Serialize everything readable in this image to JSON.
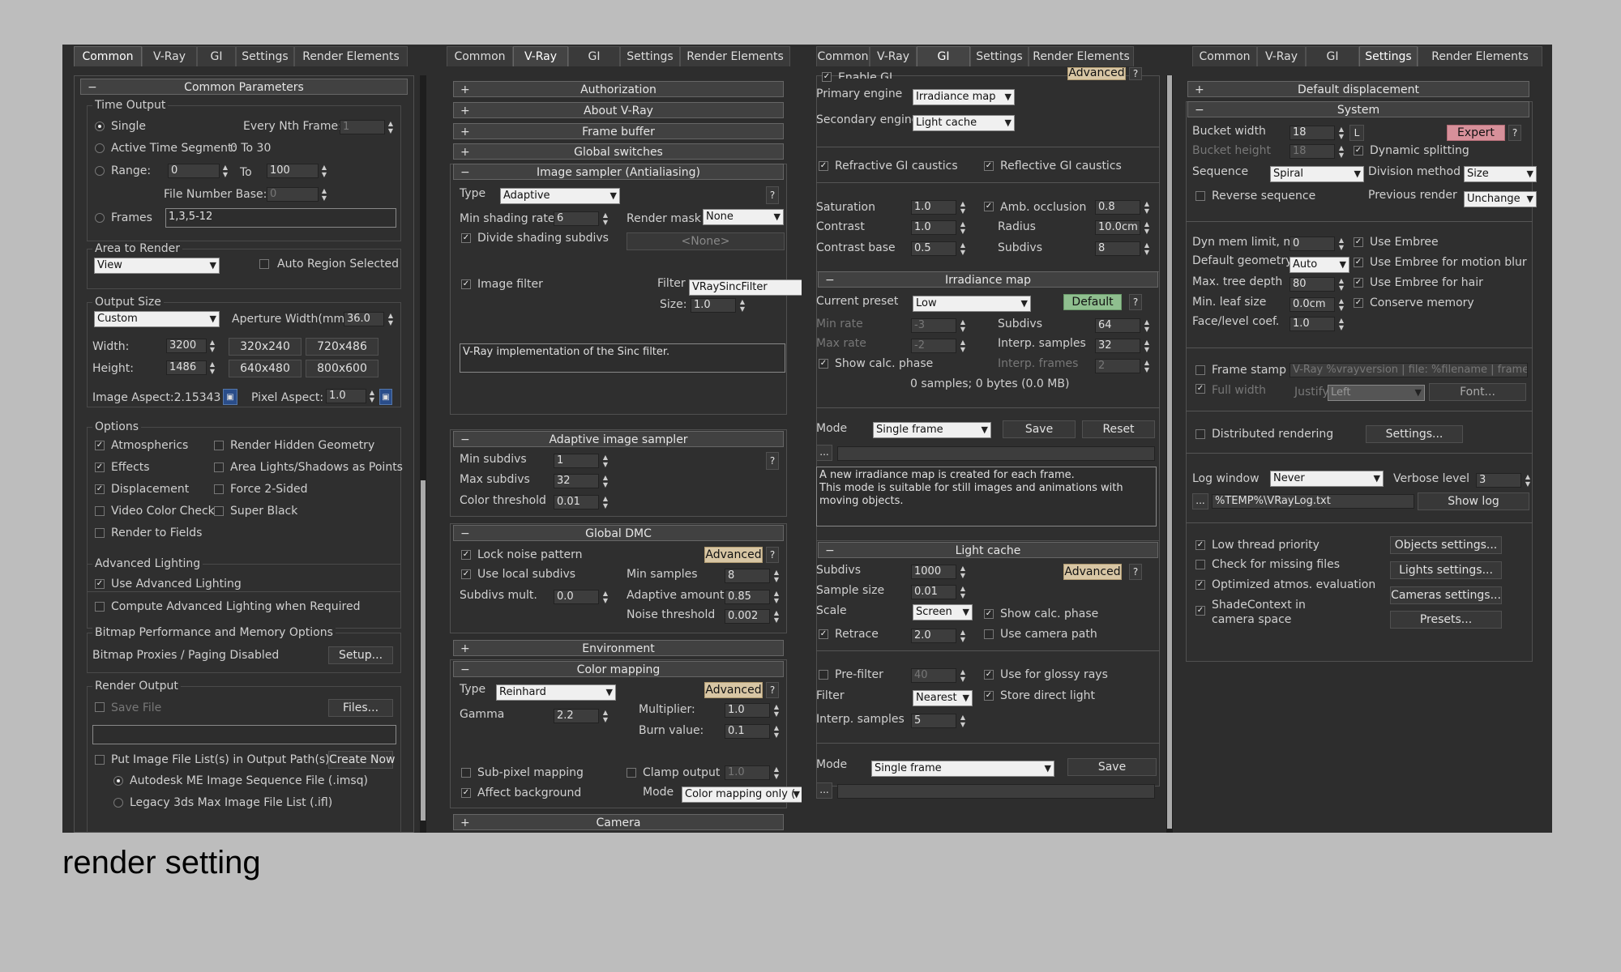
{
  "caption": "render setting",
  "tabs": [
    "Common",
    "V-Ray",
    "GI",
    "Settings",
    "Render Elements"
  ],
  "p1": {
    "common_params": "Common Parameters",
    "time_output": "Time Output",
    "single": "Single",
    "every_nth": "Every Nth Frame:",
    "every_nth_val": "1",
    "active_time": "Active Time Segment:",
    "active_time_val": "0 To 30",
    "range": "Range:",
    "range_from": "0",
    "to": "To",
    "range_to": "100",
    "file_num_base": "File Number Base:",
    "file_num_base_val": "0",
    "frames": "Frames",
    "frames_val": "1,3,5-12",
    "area_to_render": "Area to Render",
    "view": "View",
    "auto_region": "Auto Region Selected",
    "output_size": "Output Size",
    "custom": "Custom",
    "aperture": "Aperture Width(mm):",
    "aperture_val": "36.0",
    "width": "Width:",
    "width_val": "3200",
    "height": "Height:",
    "height_val": "1486",
    "preset1": "320x240",
    "preset2": "720x486",
    "preset3": "640x480",
    "preset4": "800x600",
    "image_aspect": "Image Aspect:2.15343",
    "pixel_aspect": "Pixel Aspect:",
    "pixel_aspect_val": "1.0",
    "options": "Options",
    "atmospherics": "Atmospherics",
    "render_hidden": "Render Hidden Geometry",
    "effects": "Effects",
    "area_lights": "Area Lights/Shadows as Points",
    "displacement": "Displacement",
    "force2": "Force 2-Sided",
    "video_color": "Video Color Check",
    "super_black": "Super Black",
    "render_fields": "Render to Fields",
    "adv_lighting": "Advanced Lighting",
    "use_adv": "Use Advanced Lighting",
    "compute_adv": "Compute Advanced Lighting when Required",
    "bitmap_perf": "Bitmap Performance and Memory Options",
    "bitmap_proxies": "Bitmap Proxies / Paging Disabled",
    "setup": "Setup...",
    "render_output": "Render Output",
    "save_file": "Save File",
    "files": "Files...",
    "put_image": "Put Image File List(s) in Output Path(s)",
    "create_now": "Create Now",
    "autodesk_me": "Autodesk ME Image Sequence File (.imsq)",
    "legacy": "Legacy 3ds Max Image File List (.ifl)"
  },
  "p2": {
    "authorization": "Authorization",
    "about": "About V-Ray",
    "frame_buffer": "Frame buffer",
    "global_switches": "Global switches",
    "image_sampler": "Image sampler (Antialiasing)",
    "type": "Type",
    "type_val": "Adaptive",
    "min_shading": "Min shading rate",
    "min_shading_val": "6",
    "render_mask": "Render mask",
    "render_mask_val": "None",
    "divide": "Divide shading subdivs",
    "none_btn": "<None>",
    "image_filter": "Image filter",
    "filter": "Filter",
    "filter_val": "VRaySincFilter",
    "size": "Size:",
    "size_val": "1.0",
    "filter_desc": "V-Ray implementation of the Sinc filter.",
    "adaptive_sampler": "Adaptive image sampler",
    "min_subdivs": "Min subdivs",
    "min_subdivs_val": "1",
    "max_subdivs": "Max subdivs",
    "max_subdivs_val": "32",
    "color_thr": "Color threshold",
    "color_thr_val": "0.01",
    "global_dmc": "Global DMC",
    "lock_noise": "Lock noise pattern",
    "advanced": "Advanced",
    "use_local": "Use local subdivs",
    "min_samples": "Min samples",
    "min_samples_val": "8",
    "subdivs_mult": "Subdivs mult.",
    "subdivs_mult_val": "0.0",
    "adaptive_amount": "Adaptive amount",
    "adaptive_amount_val": "0.85",
    "noise_thr": "Noise threshold",
    "noise_thr_val": "0.002",
    "environment": "Environment",
    "color_mapping": "Color mapping",
    "cm_type_val": "Reinhard",
    "multiplier": "Multiplier:",
    "multiplier_val": "1.0",
    "gamma": "Gamma",
    "gamma_val": "2.2",
    "burn": "Burn value:",
    "burn_val": "0.1",
    "subpixel": "Sub-pixel mapping",
    "clamp": "Clamp output",
    "clamp_val": "1.0",
    "affect_bg": "Affect background",
    "mode": "Mode",
    "mode_val": "Color mapping only (",
    "camera": "Camera"
  },
  "p3": {
    "enable_gi": "Enable GI",
    "advanced": "Advanced",
    "primary": "Primary engine",
    "primary_val": "Irradiance map",
    "secondary": "Secondary engine",
    "secondary_val": "Light cache",
    "refr_caustics": "Refractive GI caustics",
    "refl_caustics": "Reflective GI caustics",
    "saturation": "Saturation",
    "saturation_val": "1.0",
    "amb_occ": "Amb. occlusion",
    "amb_occ_val": "0.8",
    "contrast": "Contrast",
    "contrast_val": "1.0",
    "radius": "Radius",
    "radius_val": "10.0cm",
    "contrast_base": "Contrast base",
    "contrast_base_val": "0.5",
    "subdivs": "Subdivs",
    "subdivs_val": "8",
    "irradiance_map": "Irradiance map",
    "current_preset": "Current preset",
    "preset_val": "Low",
    "default": "Default",
    "min_rate": "Min rate",
    "min_rate_val": "-3",
    "im_subdivs_val": "64",
    "max_rate": "Max rate",
    "max_rate_val": "-2",
    "interp_samples": "Interp. samples",
    "interp_samples_val": "32",
    "show_calc": "Show calc. phase",
    "interp_frames": "Interp. frames",
    "interp_frames_val": "2",
    "samples_info": "0 samples; 0 bytes (0.0 MB)",
    "mode": "Mode",
    "mode_val": "Single frame",
    "save": "Save",
    "reset": "Reset",
    "ellipsis": "...",
    "mode_desc": "A new irradiance map is created for each frame.\nThis mode is suitable for still images and animations with moving objects.",
    "light_cache": "Light cache",
    "lc_subdivs_val": "1000",
    "sample_size": "Sample size",
    "sample_size_val": "0.01",
    "scale": "Scale",
    "scale_val": "Screen",
    "show_calc2": "Show calc. phase",
    "retrace": "Retrace",
    "retrace_val": "2.0",
    "use_camera": "Use camera path",
    "prefilter": "Pre-filter",
    "prefilter_val": "40",
    "glossy": "Use for glossy rays",
    "filter": "Filter",
    "filter_val": "Nearest",
    "store_direct": "Store direct light",
    "interp_samples2": "Interp. samples",
    "interp_samples2_val": "5",
    "lc_mode_val": "Single frame"
  },
  "p4": {
    "default_disp": "Default displacement",
    "system": "System",
    "bucket_w": "Bucket width",
    "bucket_w_val": "18",
    "l": "L",
    "expert": "Expert",
    "bucket_h": "Bucket height",
    "bucket_h_val": "18",
    "dynamic_split": "Dynamic splitting",
    "sequence": "Sequence",
    "sequence_val": "Spiral",
    "division": "Division method",
    "division_val": "Size",
    "reverse": "Reverse sequence",
    "prev_render": "Previous render",
    "prev_render_val": "Unchange",
    "dyn_mem": "Dyn mem limit, mb",
    "dyn_mem_val": "0",
    "use_embree": "Use Embree",
    "default_geom": "Default geometry",
    "default_geom_val": "Auto",
    "embree_motion": "Use Embree for motion blur",
    "max_tree": "Max. tree depth",
    "max_tree_val": "80",
    "embree_hair": "Use Embree for hair",
    "min_leaf": "Min. leaf size",
    "min_leaf_val": "0.0cm",
    "conserve": "Conserve memory",
    "face_level": "Face/level coef.",
    "face_level_val": "1.0",
    "frame_stamp": "Frame stamp",
    "frame_stamp_val": "V-Ray %vrayversion | file: %filename | frame",
    "full_width": "Full width",
    "justify": "Justify",
    "justify_val": "Left",
    "font": "Font...",
    "distributed": "Distributed rendering",
    "settings": "Settings...",
    "log_window": "Log window",
    "log_window_val": "Never",
    "verbose": "Verbose level",
    "verbose_val": "3",
    "ellipsis": "...",
    "log_path": "%TEMP%\\VRayLog.txt",
    "show_log": "Show log",
    "low_thread": "Low thread priority",
    "objects_settings": "Objects settings...",
    "check_missing": "Check for missing files",
    "lights_settings": "Lights settings...",
    "optimized_atmos": "Optimized atmos. evaluation",
    "cameras_settings": "Cameras settings...",
    "shadecontext": "ShadeContext in camera space",
    "presets": "Presets..."
  }
}
